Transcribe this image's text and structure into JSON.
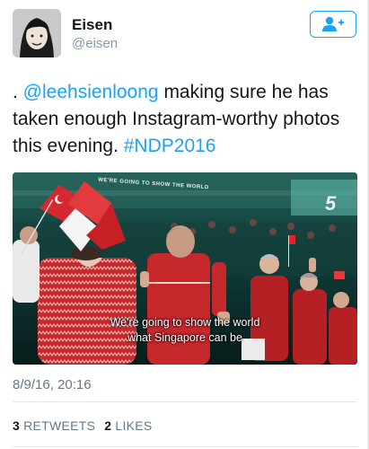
{
  "author": {
    "name": "Eisen",
    "handle": "@eisen"
  },
  "tweet": {
    "prefix": ". ",
    "mention": "@leehsienloong",
    "body": " making sure he has taken enough Instagram-worthy photos this evening. ",
    "hashtag": "#NDP2016"
  },
  "media": {
    "subtitle_line1": "We're going to show the world",
    "subtitle_line2": "what Singapore can be",
    "colors": {
      "flag_red": "#d7282f",
      "shirt_red": "#c6282c",
      "stadium": "#0d2e2a"
    }
  },
  "timestamp": "8/9/16, 20:16",
  "stats": {
    "retweets_count": "3",
    "retweets_label": "RETWEETS",
    "likes_count": "2",
    "likes_label": "LIKES"
  },
  "icons": {
    "follow": "add-user-icon"
  },
  "colors": {
    "link": "#1da1f2",
    "muted": "#657786",
    "text": "#14171a"
  }
}
